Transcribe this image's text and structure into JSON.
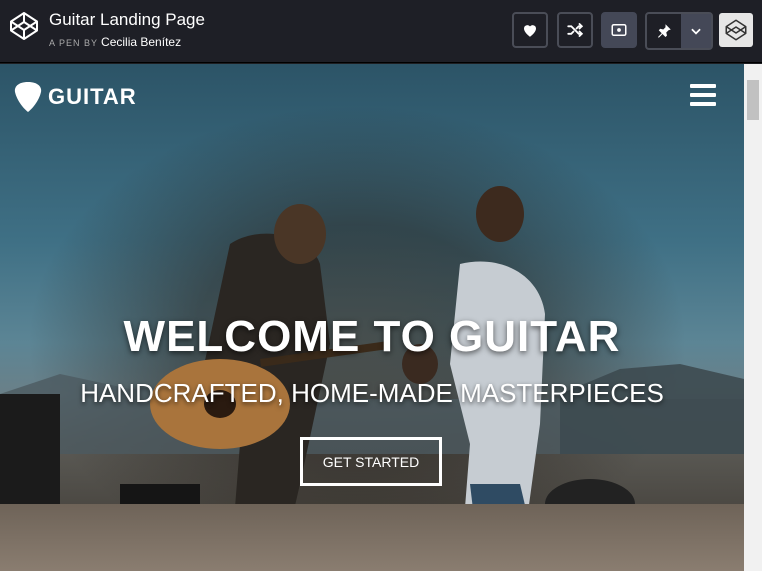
{
  "codepen": {
    "title": "Guitar Landing Page",
    "byline_prefix": "A PEN BY",
    "author": "Cecilia Benítez",
    "buttons": [
      "heart-icon",
      "fork-icon",
      "view-icon",
      "pin-icon",
      "chevron-down-icon"
    ]
  },
  "site": {
    "brand": "GUITAR",
    "hero_title": "WELCOME TO GUITAR",
    "hero_subtitle": "HANDCRAFTED, HOME-MADE MASTERPIECES",
    "cta_label": "GET STARTED"
  }
}
